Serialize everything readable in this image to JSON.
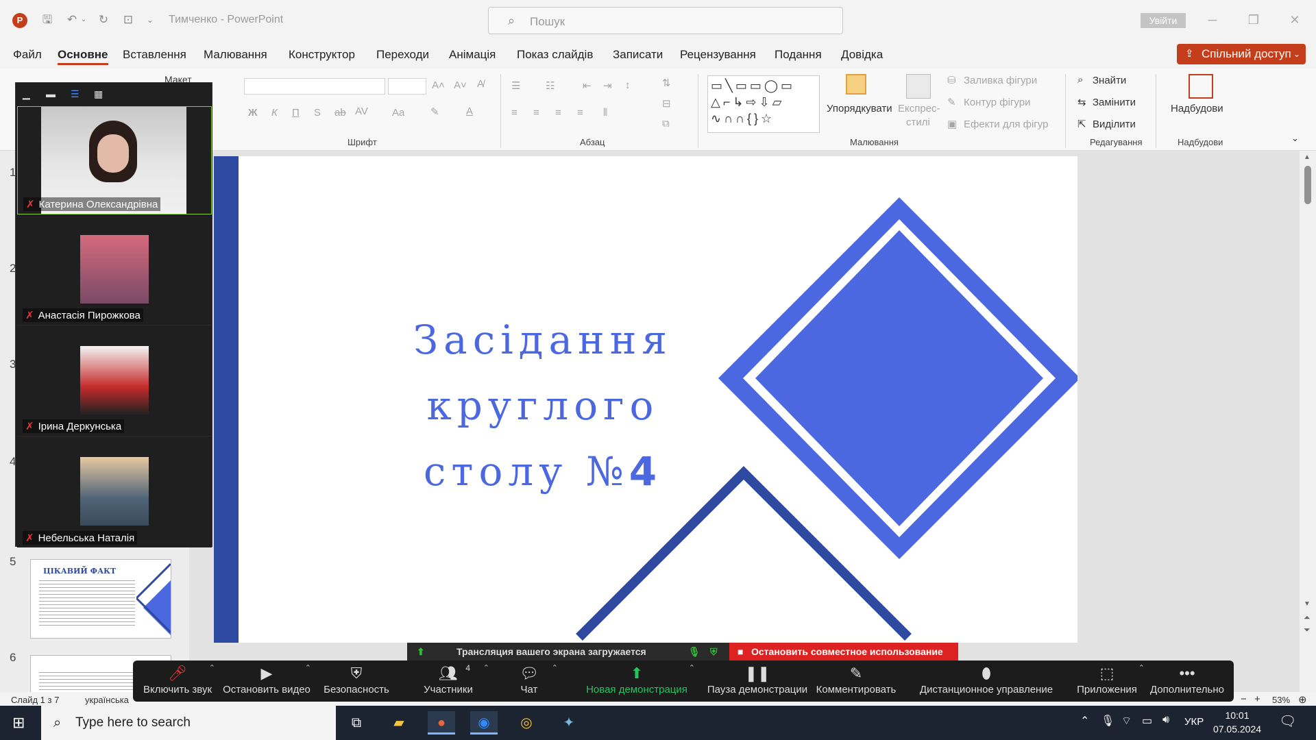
{
  "titlebar": {
    "doc_title": "Тимченко  -  PowerPoint",
    "search_placeholder": "Пошук",
    "signin_label": "Увійти"
  },
  "menu": {
    "items": [
      "Файл",
      "Основне",
      "Вставлення",
      "Малювання",
      "Конструктор",
      "Переходи",
      "Анімація",
      "Показ слайдів",
      "Записати",
      "Рецензування",
      "Подання",
      "Довідка"
    ],
    "active_index": 1,
    "share_label": "Спільний доступ"
  },
  "ribbon": {
    "layout_label": "Макет",
    "font_group": "Шрифт",
    "paragraph_group": "Абзац",
    "drawing_group": "Малювання",
    "editing_group": "Редагування",
    "addins_group": "Надбудови",
    "arrange_label": "Упорядкувати",
    "quick_styles_label": "Експрес-",
    "quick_styles_label2": "стилі",
    "shape_fill": "Заливка фігури",
    "shape_outline": "Контур фігури",
    "shape_effects": "Ефекти для фігур",
    "find": "Знайти",
    "replace": "Замінити",
    "select": "Виділити",
    "addins_btn": "Надбудови",
    "font_bold": "Ж",
    "font_italic": "К",
    "font_underline": "П",
    "font_strike": "S",
    "font_ab": "ab",
    "font_av": "AV",
    "font_case": "Aa",
    "font_a": "A"
  },
  "slides": {
    "numbers": [
      "1",
      "2",
      "3",
      "4",
      "5",
      "6"
    ],
    "thumb5_title": "ЦІКАВИЙ ФАКТ",
    "current_title_line1": "Засідання круглого",
    "current_title_line2": "столу №",
    "current_title_num": "4"
  },
  "statusbar": {
    "slide_info": "Слайд 1 з 7",
    "language": "українська",
    "zoom": "53%",
    "zoom_minus": "−",
    "zoom_plus": "+"
  },
  "zoom": {
    "participants": [
      {
        "name": "Катерина Олександрівна"
      },
      {
        "name": "Анастасія Пирожкова"
      },
      {
        "name": "Ірина Деркунська"
      },
      {
        "name": "Небельська Наталія"
      }
    ],
    "share_status": "Трансляция вашего экрана загружается",
    "stop_share": "Остановить совместное использование",
    "participants_count": "4",
    "toolbar": [
      {
        "label": "Включить звук",
        "icon": "mic-muted-icon"
      },
      {
        "label": "Остановить видео",
        "icon": "video-icon"
      },
      {
        "label": "Безопасность",
        "icon": "shield-icon"
      },
      {
        "label": "Участники",
        "icon": "participants-icon"
      },
      {
        "label": "Чат",
        "icon": "chat-icon"
      },
      {
        "label": "Новая демонстрация",
        "icon": "share-screen-icon"
      },
      {
        "label": "Пауза демонстрации",
        "icon": "pause-icon"
      },
      {
        "label": "Комментировать",
        "icon": "pen-icon"
      },
      {
        "label": "Дистанционное управление",
        "icon": "mouse-icon"
      },
      {
        "label": "Приложения",
        "icon": "apps-icon"
      },
      {
        "label": "Дополнительно",
        "icon": "more-icon"
      }
    ]
  },
  "taskbar": {
    "search_placeholder": "Type here to search",
    "lang": "УКР",
    "time": "10:01",
    "date": "07.05.2024"
  },
  "colors": {
    "accent": "#c43e1c",
    "slide_blue": "#4c68e0",
    "slide_dark": "#2e4aa0",
    "zoom_green": "#22c55e",
    "stop_red": "#dd2222"
  }
}
